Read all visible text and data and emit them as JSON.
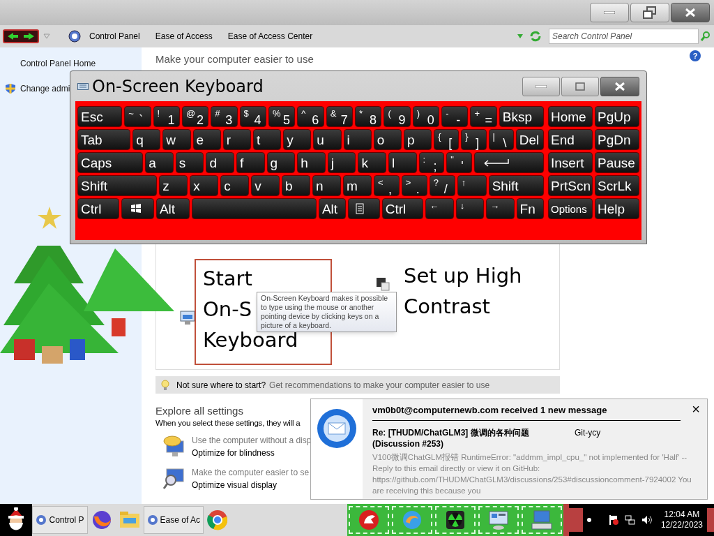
{
  "control_panel": {
    "breadcrumbs": [
      "Control Panel",
      "Ease of Access",
      "Ease of Access Center"
    ],
    "search": {
      "placeholder": "Search Control Panel"
    },
    "sidebar": {
      "items": [
        "Control Panel Home",
        "Change admi"
      ]
    },
    "heading": "Make your computer easier to use",
    "help": "?",
    "quick_access": [
      {
        "lines": [
          "Start",
          "On-S",
          "Keyboard"
        ],
        "selected": true
      },
      {
        "lines": [
          "Set up High",
          "Contrast"
        ],
        "selected": false
      }
    ],
    "tooltip": "On-Screen Keyboard makes it possible to type using the mouse or another pointing device by clicking keys on a picture of a keyboard.",
    "tip": {
      "text": "Not sure where to start?",
      "link": "Get recommendations to make your computer easier to use"
    },
    "explore": {
      "title": "Explore all settings",
      "subtitle": "When you select these settings, they will a",
      "items": [
        {
          "description": "Use the computer without a disp",
          "link": "Optimize for blindness"
        },
        {
          "description": "Make the computer easier to se",
          "link": "Optimize visual display"
        }
      ]
    }
  },
  "osk": {
    "title": "On-Screen Keyboard",
    "rows": [
      {
        "keys": [
          {
            "kind": "text",
            "label": "Esc"
          },
          {
            "kind": "pair",
            "shift": "~",
            "label": "`"
          },
          {
            "kind": "pair",
            "shift": "!",
            "label": "1"
          },
          {
            "kind": "pair",
            "shift": "@",
            "label": "2"
          },
          {
            "kind": "pair",
            "shift": "#",
            "label": "3"
          },
          {
            "kind": "pair",
            "shift": "$",
            "label": "4"
          },
          {
            "kind": "pair",
            "shift": "%",
            "label": "5"
          },
          {
            "kind": "pair",
            "shift": "^",
            "label": "6"
          },
          {
            "kind": "pair",
            "shift": "&",
            "label": "7"
          },
          {
            "kind": "pair",
            "shift": "*",
            "label": "8"
          },
          {
            "kind": "pair",
            "shift": "(",
            "label": "9"
          },
          {
            "kind": "pair",
            "shift": ")",
            "label": "0"
          },
          {
            "kind": "pair",
            "shift": "-",
            "label": "-"
          },
          {
            "kind": "pair",
            "shift": "+",
            "label": "="
          },
          {
            "kind": "text",
            "label": "Bksp"
          }
        ],
        "nav": [
          "Home",
          "PgUp"
        ]
      },
      {
        "keys": [
          {
            "kind": "text",
            "label": "Tab"
          },
          {
            "kind": "text",
            "label": "q"
          },
          {
            "kind": "text",
            "label": "w"
          },
          {
            "kind": "text",
            "label": "e"
          },
          {
            "kind": "text",
            "label": "r"
          },
          {
            "kind": "text",
            "label": "t"
          },
          {
            "kind": "text",
            "label": "y"
          },
          {
            "kind": "text",
            "label": "u"
          },
          {
            "kind": "text",
            "label": "i"
          },
          {
            "kind": "text",
            "label": "o"
          },
          {
            "kind": "text",
            "label": "p"
          },
          {
            "kind": "pair",
            "shift": "{",
            "label": "["
          },
          {
            "kind": "pair",
            "shift": "}",
            "label": "]"
          },
          {
            "kind": "pair",
            "shift": "|",
            "label": "\\"
          },
          {
            "kind": "text",
            "label": "Del"
          }
        ],
        "nav": [
          "End",
          "PgDn"
        ]
      },
      {
        "keys": [
          {
            "kind": "text",
            "label": "Caps"
          },
          {
            "kind": "text",
            "label": "a"
          },
          {
            "kind": "text",
            "label": "s"
          },
          {
            "kind": "text",
            "label": "d"
          },
          {
            "kind": "text",
            "label": "f"
          },
          {
            "kind": "text",
            "label": "g"
          },
          {
            "kind": "text",
            "label": "h"
          },
          {
            "kind": "text",
            "label": "j"
          },
          {
            "kind": "text",
            "label": "k"
          },
          {
            "kind": "text",
            "label": "l"
          },
          {
            "kind": "pair",
            "shift": ":",
            "label": ";"
          },
          {
            "kind": "pair",
            "shift": "\"",
            "label": "'"
          },
          {
            "kind": "enter"
          }
        ],
        "nav": [
          "Insert",
          "Pause"
        ]
      },
      {
        "keys": [
          {
            "kind": "text",
            "label": "Shift"
          },
          {
            "kind": "text",
            "label": "z"
          },
          {
            "kind": "text",
            "label": "x"
          },
          {
            "kind": "text",
            "label": "c"
          },
          {
            "kind": "text",
            "label": "v"
          },
          {
            "kind": "text",
            "label": "b"
          },
          {
            "kind": "text",
            "label": "n"
          },
          {
            "kind": "text",
            "label": "m"
          },
          {
            "kind": "pair",
            "shift": "<",
            "label": ","
          },
          {
            "kind": "pair",
            "shift": ">",
            "label": "."
          },
          {
            "kind": "pair",
            "shift": "?",
            "label": "/"
          },
          {
            "kind": "arrow",
            "label": "↑"
          },
          {
            "kind": "text",
            "label": "Shift"
          }
        ],
        "nav": [
          "PrtScn",
          "ScrLk"
        ]
      },
      {
        "keys": [
          {
            "kind": "text",
            "label": "Ctrl"
          },
          {
            "kind": "logo"
          },
          {
            "kind": "text",
            "label": "Alt"
          },
          {
            "kind": "space"
          },
          {
            "kind": "text",
            "label": "Alt"
          },
          {
            "kind": "menu"
          },
          {
            "kind": "text",
            "label": "Ctrl"
          },
          {
            "kind": "arrow",
            "label": "←"
          },
          {
            "kind": "arrow",
            "label": "↓"
          },
          {
            "kind": "arrow",
            "label": "→"
          },
          {
            "kind": "text",
            "label": "Fn"
          }
        ],
        "nav": [
          "Options",
          "Help"
        ]
      }
    ]
  },
  "notification": {
    "header": "vm0b0t@computernewb.com received 1 new message",
    "close": "×",
    "subject": "Re: [THUDM/ChatGLM3] 微调的各种问题 (Discussion #253)",
    "sender": "Git-ycy",
    "preview": "V100微调ChatGLM报错 RuntimeError: \"addmm_impl_cpu_\" not implemented for 'Half' -- Reply to this email directly or view it on GitHub: https://github.com/THUDM/ChatGLM3/discussions/253#discussioncomment-7924002 You are receiving this because you"
  },
  "taskbar": {
    "tasks": [
      {
        "label": "Control P"
      },
      {
        "label": "Ease of Ac"
      }
    ],
    "clock": {
      "time": "12:04 AM",
      "date": "12/22/2023"
    }
  }
}
